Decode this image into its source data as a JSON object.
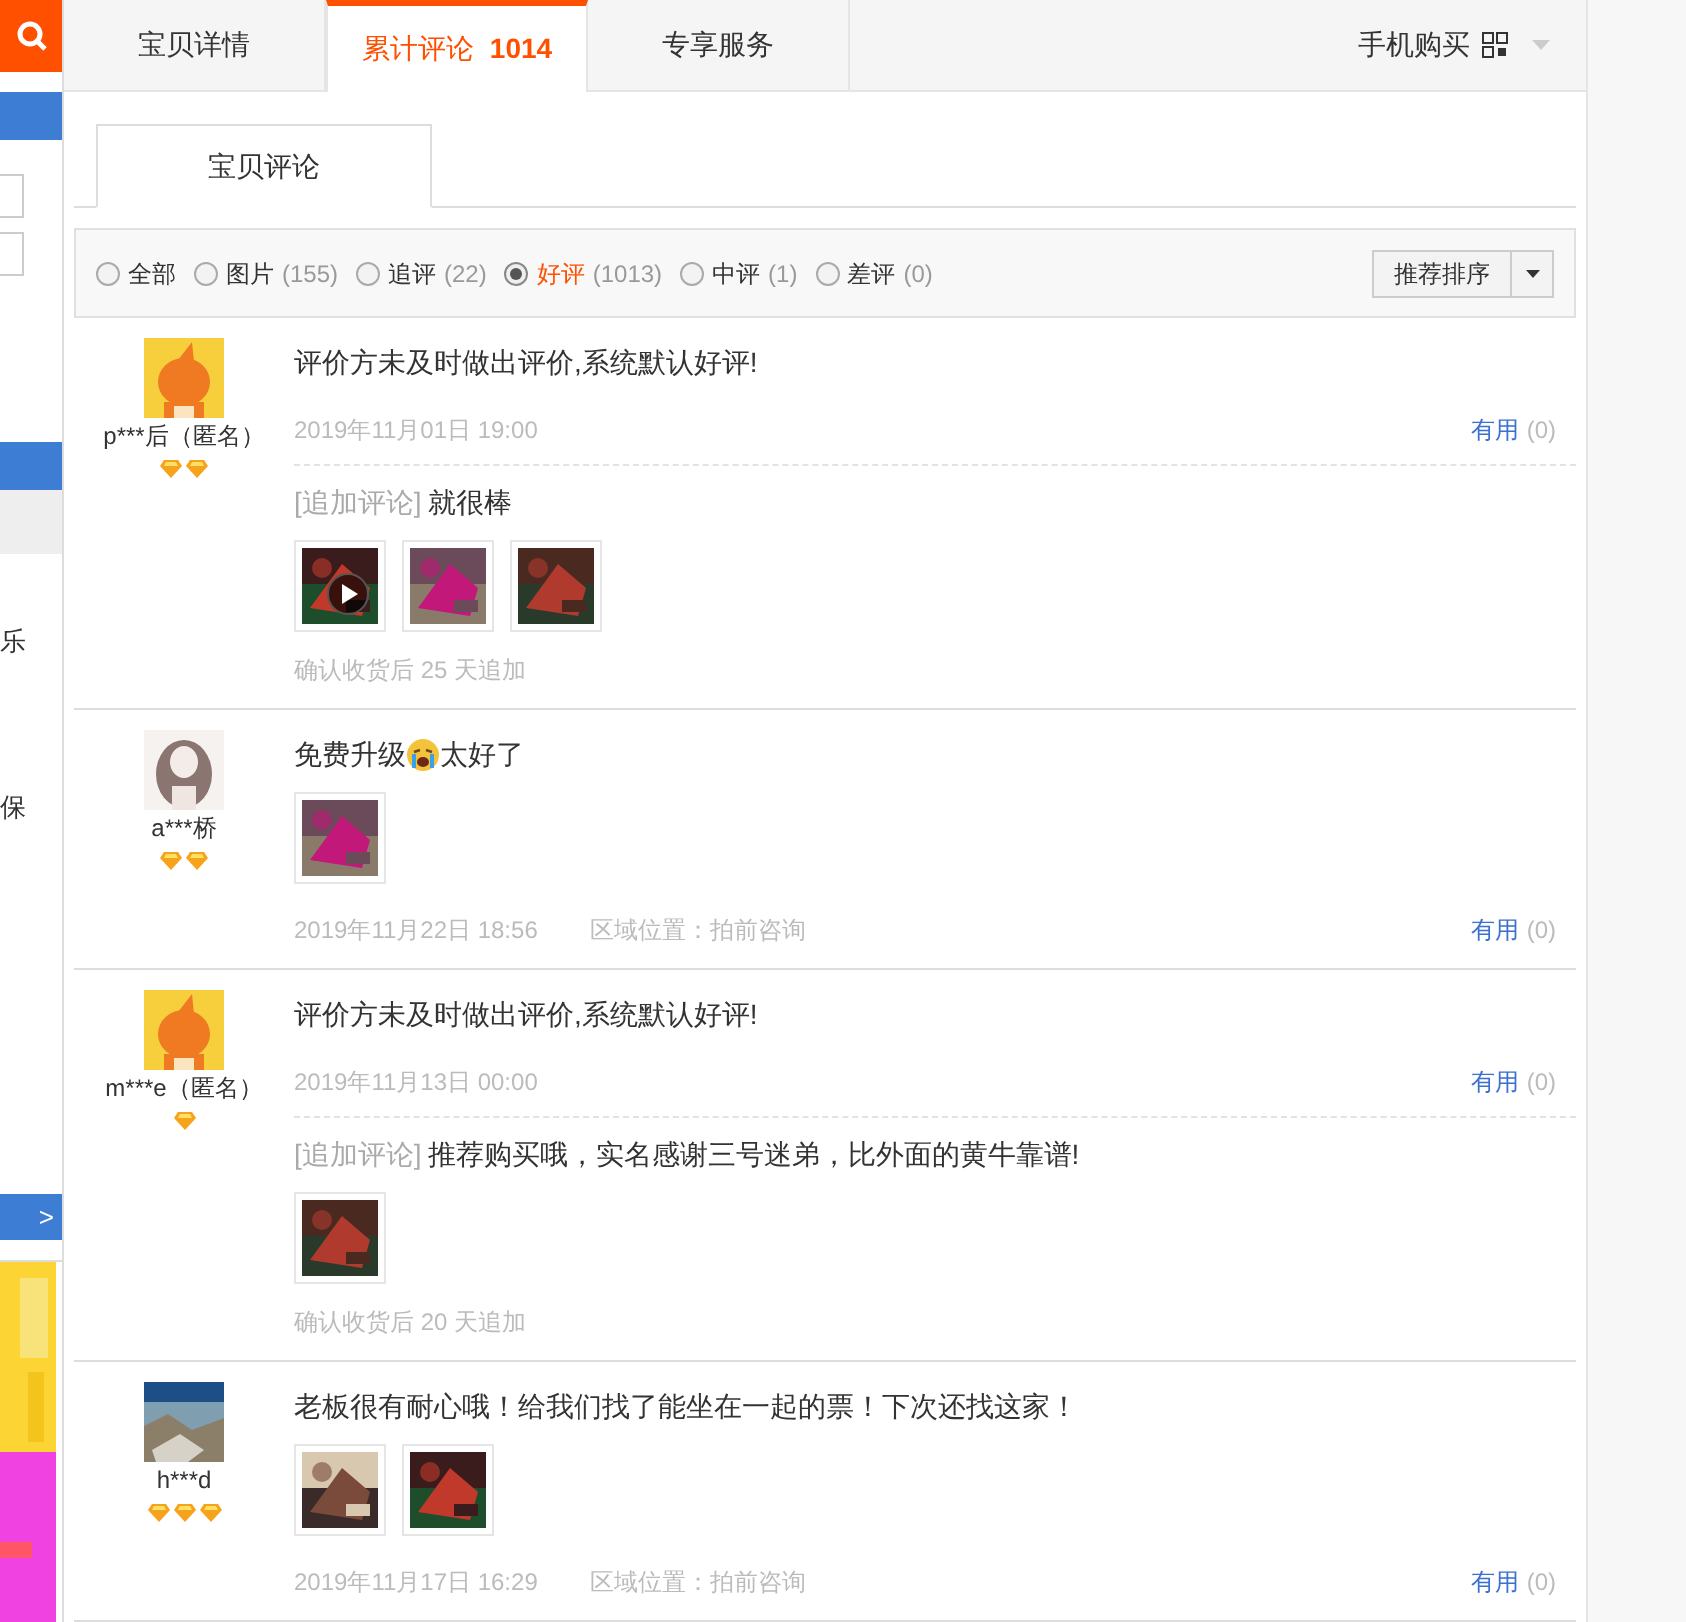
{
  "sidebar": {
    "fragments": [
      "乐",
      "保"
    ],
    "more_button": ">"
  },
  "tabs": [
    {
      "label": "宝贝详情",
      "selected": false
    },
    {
      "label": "累计评论",
      "count": "1014",
      "selected": true
    },
    {
      "label": "专享服务",
      "selected": false
    }
  ],
  "mobile_buy": {
    "label": "手机购买"
  },
  "subtab": {
    "label": "宝贝评论"
  },
  "filters": [
    {
      "label": "全部",
      "selected": false
    },
    {
      "label": "图片",
      "count": "(155)",
      "selected": false
    },
    {
      "label": "追评",
      "count": "(22)",
      "selected": false
    },
    {
      "label": "好评",
      "count": "(1013)",
      "selected": true
    },
    {
      "label": "中评",
      "count": "(1)",
      "selected": false
    },
    {
      "label": "差评",
      "count": "(0)",
      "selected": false
    }
  ],
  "sort_button": {
    "label": "推荐排序"
  },
  "reviews": [
    {
      "user": "p***后（匿名）",
      "rank": [
        {
          "kind": "diamond"
        },
        {
          "kind": "diamond"
        }
      ],
      "content": [
        {
          "kind": "text",
          "text": "评价方未及时做出评价,系统默认好评!"
        }
      ],
      "date": "2019年11月01日 19:00",
      "useful": "有用",
      "useful_count": "(0)",
      "followup": {
        "label": "[追加评论]",
        "text": "就很棒",
        "photos": [
          {
            "kind": "video"
          },
          {
            "kind": "picture"
          },
          {
            "kind": "picture"
          }
        ],
        "note": "确认收货后 25 天追加"
      }
    },
    {
      "user": "a***桥",
      "rank": [
        {
          "kind": "diamond"
        },
        {
          "kind": "diamond"
        }
      ],
      "content": [
        {
          "kind": "text",
          "text": "免费升级"
        },
        {
          "kind": "emoji"
        },
        {
          "kind": "text",
          "text": "太好了"
        }
      ],
      "photos": [
        {
          "kind": "picture"
        }
      ],
      "date": "2019年11月22日 18:56",
      "location": "区域位置：拍前咨询",
      "useful": "有用",
      "useful_count": "(0)"
    },
    {
      "user": "m***e（匿名）",
      "rank": [
        {
          "kind": "diamond"
        }
      ],
      "content": [
        {
          "kind": "text",
          "text": "评价方未及时做出评价,系统默认好评!"
        }
      ],
      "date": "2019年11月13日 00:00",
      "useful": "有用",
      "useful_count": "(0)",
      "followup": {
        "label": "[追加评论]",
        "text": "推荐购买哦，实名感谢三号迷弟，比外面的黄牛靠谱!",
        "photos": [
          {
            "kind": "picture"
          }
        ],
        "note": "确认收货后 20 天追加"
      }
    },
    {
      "user": "h***d",
      "rank": [
        {
          "kind": "diamond"
        },
        {
          "kind": "diamond"
        },
        {
          "kind": "diamond"
        }
      ],
      "content": [
        {
          "kind": "text",
          "text": "老板很有耐心哦！给我们找了能坐在一起的票！下次还找这家！"
        }
      ],
      "photos": [
        {
          "kind": "picture"
        },
        {
          "kind": "picture"
        }
      ],
      "date": "2019年11月17日 16:29",
      "location": "区域位置：拍前咨询",
      "useful": "有用",
      "useful_count": "(0)"
    }
  ]
}
